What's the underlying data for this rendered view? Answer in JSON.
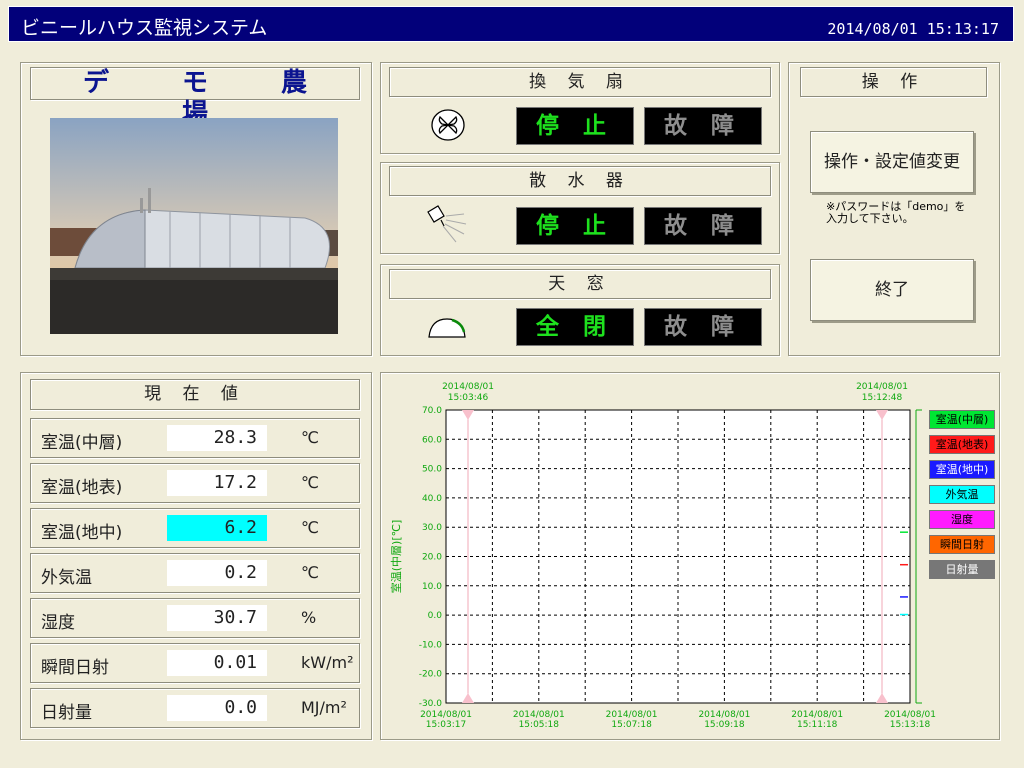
{
  "app": {
    "title": "ビニールハウス監視システム",
    "datetime": "2014/08/01  15:13:17"
  },
  "farm": {
    "name": "デ モ 農 場"
  },
  "devices": [
    {
      "title": "換 気 扇",
      "icon": "fan-icon",
      "state": "停 止",
      "fault": "故 障"
    },
    {
      "title": "散 水 器",
      "icon": "sprinkler-icon",
      "state": "停 止",
      "fault": "故 障"
    },
    {
      "title": "天 窓",
      "icon": "skylight-icon",
      "state": "全 閉",
      "fault": "故 障"
    }
  ],
  "operations": {
    "title": "操 作",
    "settings_button": "操作・設定値変更",
    "note_line1": "※パスワードは「demo」を",
    "note_line2": "入力して下さい。",
    "exit_button": "終了"
  },
  "current": {
    "title": "現 在 値",
    "rows": [
      {
        "label": "室温(中層)",
        "value": "28.3",
        "unit": "℃"
      },
      {
        "label": "室温(地表)",
        "value": "17.2",
        "unit": "℃"
      },
      {
        "label": "室温(地中)",
        "value": "6.2",
        "unit": "℃"
      },
      {
        "label": "外気温",
        "value": "0.2",
        "unit": "℃"
      },
      {
        "label": "湿度",
        "value": "30.7",
        "unit": "%"
      },
      {
        "label": "瞬間日射",
        "value": "0.01",
        "unit": "kW/m²"
      },
      {
        "label": "日射量",
        "value": "0.0",
        "unit": "MJ/m²"
      }
    ]
  },
  "chart": {
    "cursor_left_date": "2014/08/01",
    "cursor_left_time": "15:03:46",
    "cursor_right_date": "2014/08/01",
    "cursor_right_time": "15:12:48",
    "ylabel": "室温(中層)[℃]"
  },
  "legend": [
    {
      "label": "室温(中層)",
      "color": "#00e633",
      "text": "#000000"
    },
    {
      "label": "室温(地表)",
      "color": "#ff1a1a",
      "text": "#000000"
    },
    {
      "label": "室温(地中)",
      "color": "#1a1aff",
      "text": "#ffffff"
    },
    {
      "label": "外気温",
      "color": "#00ffff",
      "text": "#000000"
    },
    {
      "label": "湿度",
      "color": "#ff1aff",
      "text": "#000000"
    },
    {
      "label": "瞬間日射",
      "color": "#ff6600",
      "text": "#000000"
    },
    {
      "label": "日射量",
      "color": "#777777",
      "text": "#ffffff"
    }
  ],
  "chart_data": {
    "type": "line",
    "ylabel": "室温(中層)[℃]",
    "ylim": [
      -30,
      70
    ],
    "yticks": [
      "70.0",
      "60.0",
      "50.0",
      "40.0",
      "30.0",
      "20.0",
      "10.0",
      "0.0",
      "-10.0",
      "-20.0",
      "-30.0"
    ],
    "xticks": [
      {
        "date": "2014/08/01",
        "time": "15:03:17"
      },
      {
        "date": "2014/08/01",
        "time": "15:05:18"
      },
      {
        "date": "2014/08/01",
        "time": "15:07:18"
      },
      {
        "date": "2014/08/01",
        "time": "15:09:18"
      },
      {
        "date": "2014/08/01",
        "time": "15:11:18"
      },
      {
        "date": "2014/08/01",
        "time": "15:13:18"
      }
    ],
    "series": [
      {
        "name": "室温(中層)",
        "color": "#00e633",
        "values": [
          28.3
        ]
      },
      {
        "name": "室温(地表)",
        "color": "#ff1a1a",
        "values": [
          17.2
        ]
      },
      {
        "name": "室温(地中)",
        "color": "#1a1aff",
        "values": [
          6.2
        ]
      },
      {
        "name": "外気温",
        "color": "#00ffff",
        "values": [
          0.2
        ]
      }
    ],
    "grid": true
  }
}
